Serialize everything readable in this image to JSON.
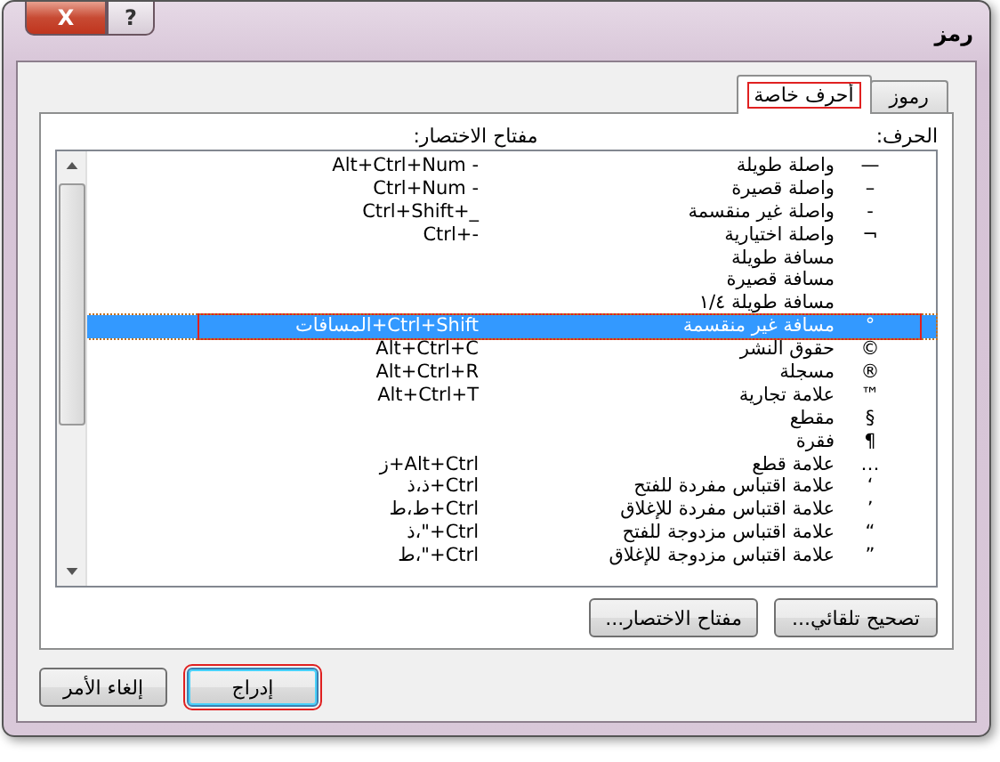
{
  "window": {
    "title": "رمز",
    "close_glyph": "X",
    "help_glyph": "?"
  },
  "tabs": [
    {
      "label": "رموز",
      "selected": false,
      "highlighted": false
    },
    {
      "label": "أحرف خاصة",
      "selected": true,
      "highlighted": true
    }
  ],
  "list": {
    "character_header": "الحرف:",
    "shortcut_header": "مفتاح الاختصار:",
    "rows": [
      {
        "symbol": "—",
        "name": "واصلة طويلة",
        "shortcut": "Alt+Ctrl+Num -",
        "selected": false,
        "highlighted": false
      },
      {
        "symbol": "–",
        "name": "واصلة قصيرة",
        "shortcut": "Ctrl+Num -",
        "selected": false,
        "highlighted": false
      },
      {
        "symbol": "-",
        "name": "واصلة غير منقسمة",
        "shortcut": "Ctrl+Shift+_",
        "selected": false,
        "highlighted": false
      },
      {
        "symbol": "¬",
        "name": "واصلة اختيارية",
        "shortcut": "Ctrl+-",
        "selected": false,
        "highlighted": false
      },
      {
        "name": "مسافة طويلة",
        "selected": false,
        "highlighted": false
      },
      {
        "name": "مسافة قصيرة",
        "selected": false,
        "highlighted": false
      },
      {
        "name": "مسافة طويلة ١/٤",
        "selected": false,
        "highlighted": false
      },
      {
        "symbol": "°",
        "name": "مسافة غير منقسمة",
        "shortcut": "المسافات+Ctrl+Shift",
        "selected": true,
        "highlighted": true
      },
      {
        "symbol": "©",
        "name": "حقوق النشر",
        "shortcut": "Alt+Ctrl+C",
        "selected": false,
        "highlighted": false
      },
      {
        "symbol": "®",
        "name": "مسجلة",
        "shortcut": "Alt+Ctrl+R",
        "selected": false,
        "highlighted": false
      },
      {
        "symbol": "™",
        "name": "علامة تجارية",
        "shortcut": "Alt+Ctrl+T",
        "selected": false,
        "highlighted": false
      },
      {
        "symbol": "§",
        "name": "مقطع",
        "selected": false,
        "highlighted": false
      },
      {
        "symbol": "¶",
        "name": "فقرة",
        "selected": false,
        "highlighted": false
      },
      {
        "symbol": "…",
        "name": "علامة قطع",
        "shortcut": "ز+Alt+Ctrl",
        "selected": false,
        "highlighted": false
      },
      {
        "symbol": "‘",
        "name": "علامة اقتباس مفردة للفتح",
        "shortcut": "ذ،ذ+Ctrl",
        "selected": false,
        "highlighted": false
      },
      {
        "symbol": "’",
        "name": "علامة اقتباس مفردة للإغلاق",
        "shortcut": "ط،ط+Ctrl",
        "selected": false,
        "highlighted": false
      },
      {
        "symbol": "“",
        "name": "علامة اقتباس مزدوجة للفتح",
        "shortcut": "ذ،\"+Ctrl",
        "selected": false,
        "highlighted": false
      },
      {
        "symbol": "”",
        "name": "علامة اقتباس مزدوجة للإغلاق",
        "shortcut": "ط،\"+Ctrl",
        "selected": false,
        "highlighted": false
      }
    ]
  },
  "panel_buttons": [
    "تصحيح تلقائي...",
    "مفتاح الاختصار..."
  ],
  "dialog_buttons": [
    {
      "label": "إدراج",
      "highlighted": true,
      "default": true
    },
    {
      "label": "إلغاء الأمر",
      "highlighted": false,
      "default": false
    }
  ]
}
